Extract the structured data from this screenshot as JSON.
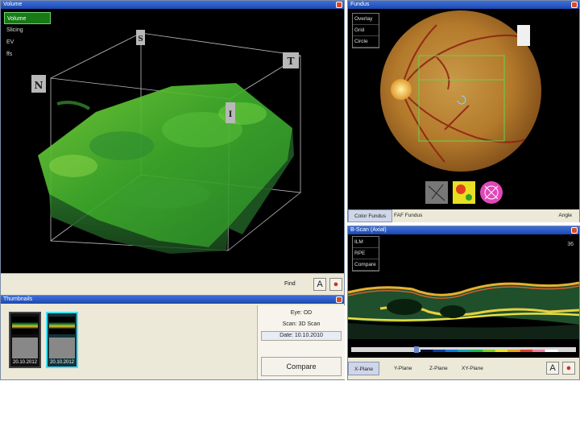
{
  "volume_window": {
    "title": "Volume",
    "view_modes": [
      "Volume",
      "Slicing",
      "EV",
      "ffs"
    ],
    "axis_labels": {
      "top": "S",
      "right": "T",
      "left": "N",
      "front": "I"
    },
    "colorbar_colors": [
      "#0b0b3a",
      "#0b3fa0",
      "#0e7ad6",
      "#10a8b0",
      "#18b84a",
      "#7fcf1c",
      "#e8e41a",
      "#f0a018",
      "#e0402a",
      "#f080a0",
      "#ffffff"
    ],
    "toolbar": {
      "label": "Find"
    }
  },
  "fundus_window": {
    "title": "Fundus",
    "overlay_menu": [
      "Overlay",
      "Grid",
      "Circle"
    ],
    "tabs": [
      "Color Fundus",
      "FAF Fundus"
    ],
    "tab_right": "Angle"
  },
  "bscan_window": {
    "title": "B-Scan (Axial)",
    "overlay_menu": [
      "ILM",
      "RPE",
      "Compare"
    ],
    "scan_index": "36",
    "tabs": [
      "X-Plane",
      "Y-Plane",
      "Z-Plane",
      "XY-Plane"
    ]
  },
  "thumbnails_window": {
    "title": "Thumbnails",
    "thumbs": [
      {
        "date": "20.10.2012",
        "selected": false
      },
      {
        "date": "20.10.2012",
        "selected": true
      }
    ],
    "info": {
      "line1": "Eye: OD",
      "line2": "Scan: 3D Scan",
      "line3": "Date: 10.10.2010"
    },
    "compare_button": "Compare"
  }
}
